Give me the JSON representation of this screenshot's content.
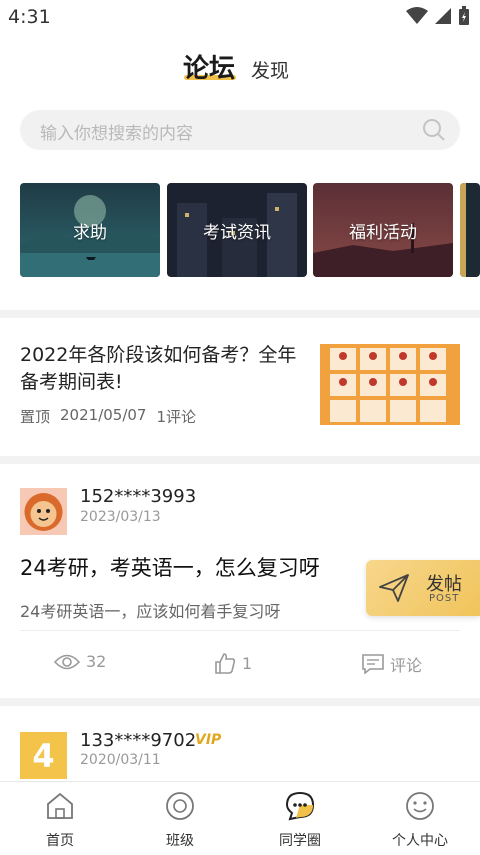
{
  "status_bar": {
    "time": "4:31"
  },
  "header": {
    "tab_active": "论坛",
    "tab_inactive": "发现"
  },
  "search": {
    "placeholder": "输入你想搜索的内容"
  },
  "categories": [
    {
      "label": "求助"
    },
    {
      "label": "考试资讯"
    },
    {
      "label": "福利活动"
    }
  ],
  "pinned_post": {
    "title": "2022年各阶段该如何备考？全年备考期间表!",
    "tag": "置顶",
    "date": "2021/05/07",
    "comments": "1评论"
  },
  "post": {
    "username": "152****3993",
    "date": "2023/03/13",
    "title": "24考研，考英语一，怎么复习呀",
    "excerpt": "24考研英语一，应该如何着手复习呀",
    "views": "32",
    "likes": "1",
    "comment_label": "评论"
  },
  "fab": {
    "label": "发帖",
    "sub": "POST"
  },
  "post2": {
    "avatar_text": "4",
    "username": "133****9702",
    "badge": "VIP",
    "date": "2020/03/11"
  },
  "bottom_nav": [
    {
      "label": "首页"
    },
    {
      "label": "班级"
    },
    {
      "label": "同学圈"
    },
    {
      "label": "个人中心"
    }
  ],
  "colors": {
    "accent": "#f2c14a",
    "fab": "#f0c45c",
    "muted": "#999999"
  }
}
